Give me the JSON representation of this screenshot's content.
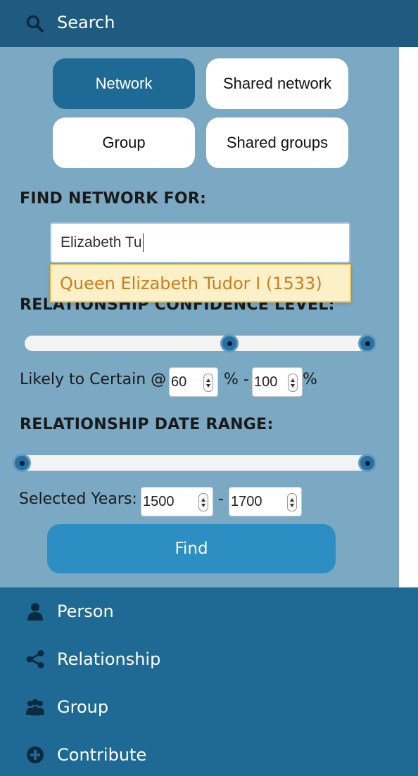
{
  "header": {
    "title": "Search",
    "icon": "search-icon"
  },
  "tabs": [
    {
      "label": "Network",
      "active": true
    },
    {
      "label": "Shared network",
      "active": false
    },
    {
      "label": "Group",
      "active": false
    },
    {
      "label": "Shared groups",
      "active": false
    }
  ],
  "find_network": {
    "label": "FIND NETWORK FOR:",
    "input_value": "Elizabeth Tu",
    "suggestion": "Queen Elizabeth Tudor I (1533)"
  },
  "confidence": {
    "label": "RELATIONSHIP CONFIDENCE LEVEL:",
    "prefix": "Likely to Certain @",
    "min": "60",
    "max": "100",
    "unit_sep": "% -",
    "unit_end": "%"
  },
  "date_range": {
    "label": "RELATIONSHIP DATE RANGE:",
    "prefix": "Selected Years:",
    "start": "1500",
    "end": "1700",
    "sep": "-"
  },
  "find_button": "Find",
  "nav": [
    {
      "label": "Person",
      "icon": "person-icon"
    },
    {
      "label": "Relationship",
      "icon": "share-icon"
    },
    {
      "label": "Group",
      "icon": "group-icon"
    },
    {
      "label": "Contribute",
      "icon": "plus-circle-icon"
    }
  ],
  "colors": {
    "header_bg": "#1f5b81",
    "panel_bg": "#7ba8c2",
    "nav_bg": "#1f6a94",
    "active_tab": "#1f6a94",
    "find_button": "#2d8ec4",
    "suggestion_text": "#c87f1f"
  }
}
